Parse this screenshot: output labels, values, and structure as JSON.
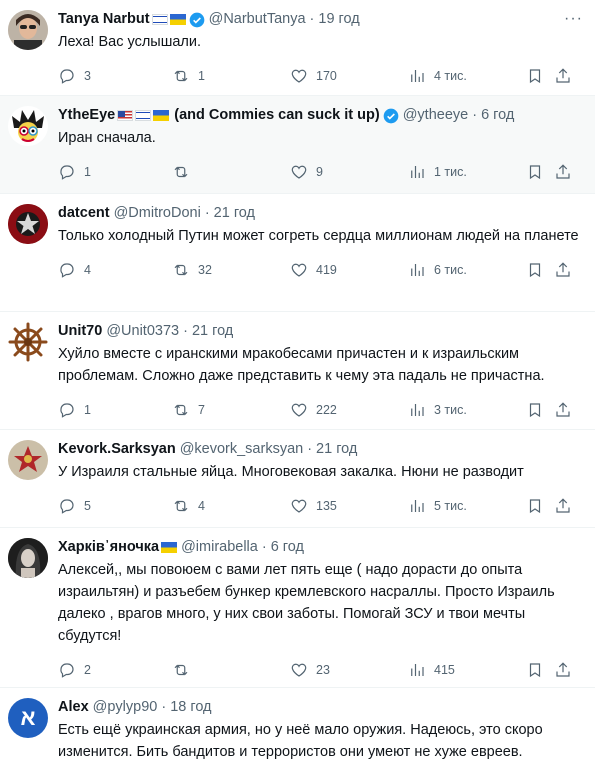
{
  "tweets": [
    {
      "name": "Tanya Narbut",
      "flags": [
        "il",
        "ua"
      ],
      "verified": true,
      "handle": "@NarbutTanya",
      "time": "19 год",
      "text": "Леха! Вас услышали.",
      "replies": "3",
      "reposts": "1",
      "likes": "170",
      "views": "4 тис.",
      "avatar_icon": "woman-sunglasses-avatar"
    },
    {
      "name": "YtheEye",
      "flags": [
        "us",
        "il",
        "ua"
      ],
      "name_suffix": "(and Commies can suck it up)",
      "verified": true,
      "handle": "@ytheeye",
      "time": "6 год",
      "text": "Иран сначала.",
      "replies": "1",
      "reposts": "",
      "likes": "9",
      "views": "1 тис.",
      "avatar_icon": "cartoon-eye-avatar"
    },
    {
      "name": "datcent",
      "flags": [],
      "verified": false,
      "handle": "@DmitroDoni",
      "time": "21 год",
      "text": "Только холодный Путин может согреть сердца миллионам людей на планете",
      "replies": "4",
      "reposts": "32",
      "likes": "419",
      "views": "6 тис.",
      "avatar_icon": "red-star-badge-avatar"
    },
    {
      "name": "Unit70",
      "flags": [],
      "verified": false,
      "handle": "@Unit0373",
      "time": "21 год",
      "text": "Хуйло вместе с иранскими мракобесами причастен и к израильским проблемам. Сложно даже представить к чему эта падаль не причастна.",
      "replies": "1",
      "reposts": "7",
      "likes": "222",
      "views": "3 тис.",
      "avatar_icon": "ship-wheel-avatar"
    },
    {
      "name": "Kevork.Sarksyan",
      "flags": [],
      "verified": false,
      "handle": "@kevork_sarksyan",
      "time": "21 год",
      "text": "У Израиля стальные яйца. Многовековая закалка. Нюни не разводит",
      "replies": "5",
      "reposts": "4",
      "likes": "135",
      "views": "5 тис.",
      "avatar_icon": "military-emblem-avatar"
    },
    {
      "name": "Харків᾽яночка",
      "flags": [
        "ua"
      ],
      "verified": false,
      "handle": "@imirabella",
      "time": "6 год",
      "text": "Алексей,, мы повоюем с вами лет пять еще  ( надо дорасти до опыта израильтян) и разъебем бункер кремлевского насраллы. Просто Израиль далеко , врагов много, у них свои заботы. Помогай ЗСУ и твои мечты сбудутся!",
      "replies": "2",
      "reposts": "",
      "likes": "23",
      "views": "415",
      "avatar_icon": "woman-portrait-avatar"
    },
    {
      "name": "Alex",
      "flags": [],
      "verified": false,
      "handle": "@pylyp90",
      "time": "18 год",
      "text": "Есть ещё украинская армия, но у неё мало оружия. Надеюсь, это скоро изменится. Бить бандитов и террористов они умеют не хуже евреев.",
      "replies": "",
      "reposts": "",
      "likes": "",
      "views": "",
      "avatar_letter": "א",
      "avatar_icon": "aleph-letter-avatar"
    }
  ],
  "colors": {
    "text": "#0f1419",
    "muted": "#536471",
    "verified": "#1d9bf0",
    "divider": "#eff3f4"
  }
}
